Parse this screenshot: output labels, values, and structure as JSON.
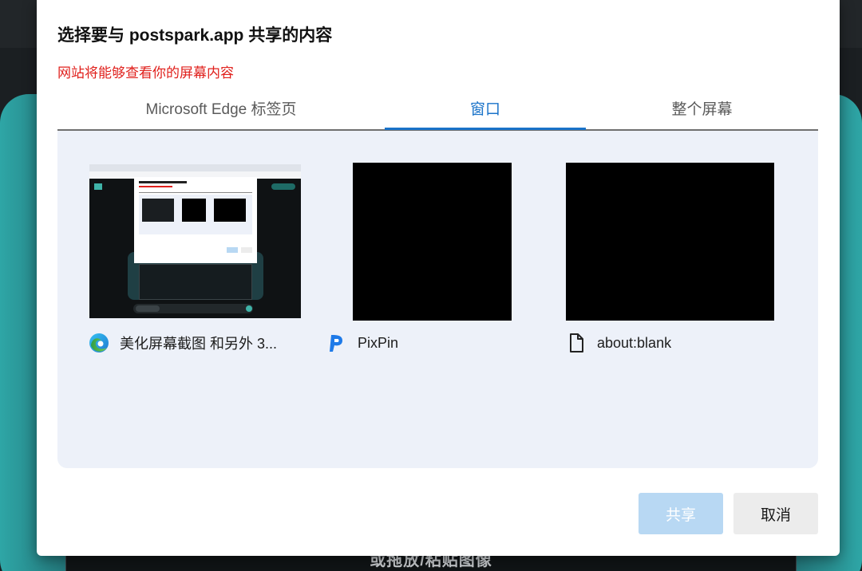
{
  "background": {
    "hint_text": "或拖放/粘贴图像"
  },
  "dialog": {
    "title": "选择要与 postspark.app 共享的内容",
    "warning": "网站将能够查看你的屏幕内容",
    "tabs": [
      {
        "label": "Microsoft Edge 标签页",
        "selected": false
      },
      {
        "label": "窗口",
        "selected": true
      },
      {
        "label": "整个屏幕",
        "selected": false
      }
    ],
    "windows": [
      {
        "label": "美化屏幕截图 和另外 3...",
        "icon": "edge-browser-icon"
      },
      {
        "label": "PixPin",
        "icon": "pixpin-app-icon"
      },
      {
        "label": "about:blank",
        "icon": "blank-document-icon"
      }
    ],
    "buttons": {
      "share": "共享",
      "cancel": "取消"
    }
  },
  "colors": {
    "accent": "#1a73c9",
    "warning": "#e0201c",
    "share_disabled": "#b8d8f3",
    "panel_bg": "#edf1f9"
  }
}
